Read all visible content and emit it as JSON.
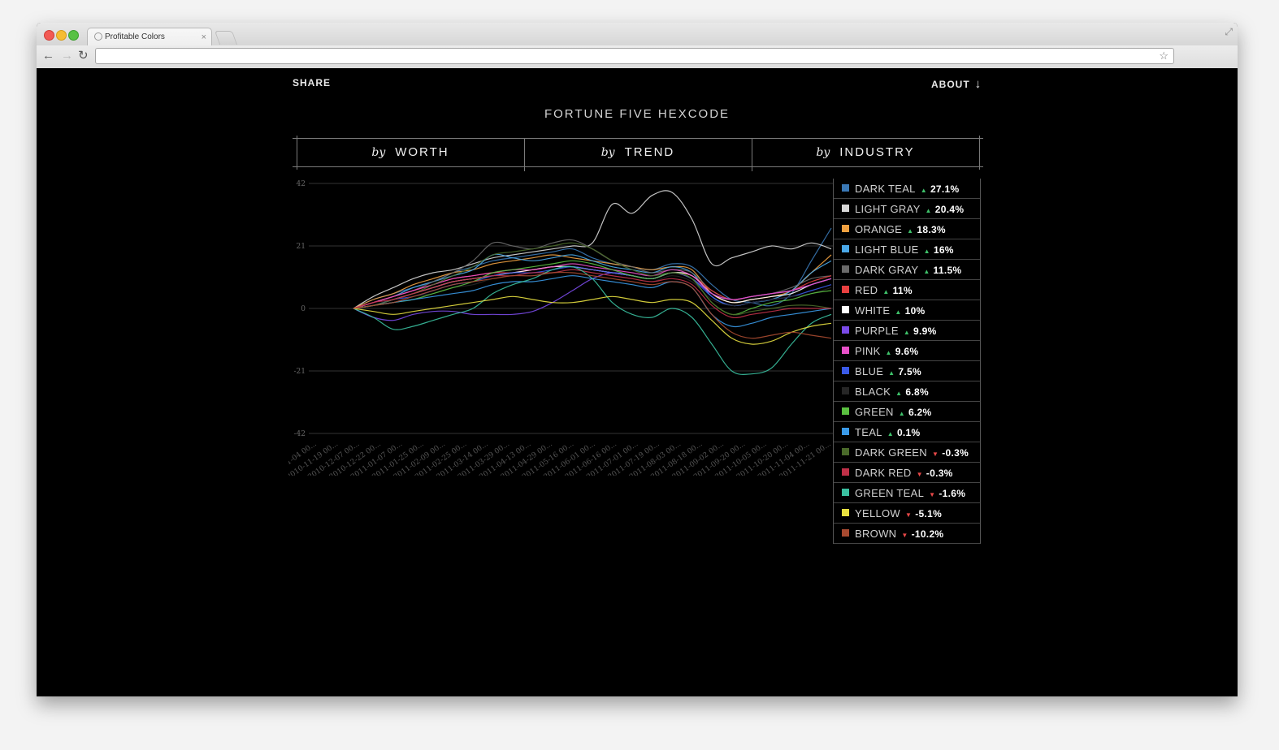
{
  "browser": {
    "tab_title": "Profitable Colors",
    "tab_close": "×",
    "back_glyph": "←",
    "forward_glyph": "→",
    "reload_glyph": "↻",
    "star_glyph": "☆",
    "fullscreen_glyph": "⤢",
    "url": ""
  },
  "header": {
    "share_label": "SHARE",
    "about_label": "ABOUT",
    "about_arrow": "↓",
    "title": "FORTUNE FIVE HEXCODE"
  },
  "tabs": [
    {
      "by": "by",
      "label": "WORTH"
    },
    {
      "by": "by",
      "label": "TREND"
    },
    {
      "by": "by",
      "label": "INDUSTRY"
    }
  ],
  "legend": [
    {
      "name": "DARK TEAL",
      "dir": "up",
      "pct": "27.1%",
      "color": "#3a78b5"
    },
    {
      "name": "LIGHT GRAY",
      "dir": "up",
      "pct": "20.4%",
      "color": "#d8d8d8"
    },
    {
      "name": "ORANGE",
      "dir": "up",
      "pct": "18.3%",
      "color": "#f0a040"
    },
    {
      "name": "LIGHT BLUE",
      "dir": "up",
      "pct": "16%",
      "color": "#4aa8e8"
    },
    {
      "name": "DARK GRAY",
      "dir": "up",
      "pct": "11.5%",
      "color": "#6a6a6a"
    },
    {
      "name": "RED",
      "dir": "up",
      "pct": "11%",
      "color": "#e84040"
    },
    {
      "name": "WHITE",
      "dir": "up",
      "pct": "10%",
      "color": "#ffffff"
    },
    {
      "name": "PURPLE",
      "dir": "up",
      "pct": "9.9%",
      "color": "#7a4ae8"
    },
    {
      "name": "PINK",
      "dir": "up",
      "pct": "9.6%",
      "color": "#e850c8"
    },
    {
      "name": "BLUE",
      "dir": "up",
      "pct": "7.5%",
      "color": "#3a5ae8"
    },
    {
      "name": "BLACK",
      "dir": "up",
      "pct": "6.8%",
      "color": "#262626"
    },
    {
      "name": "GREEN",
      "dir": "up",
      "pct": "6.2%",
      "color": "#5ac040"
    },
    {
      "name": "TEAL",
      "dir": "up",
      "pct": "0.1%",
      "color": "#3a9ae8"
    },
    {
      "name": "DARK GREEN",
      "dir": "down",
      "pct": "-0.3%",
      "color": "#4a6a2a"
    },
    {
      "name": "DARK RED",
      "dir": "down",
      "pct": "-0.3%",
      "color": "#c03048"
    },
    {
      "name": "GREEN TEAL",
      "dir": "down",
      "pct": "-1.6%",
      "color": "#3ac0a0"
    },
    {
      "name": "YELLOW",
      "dir": "down",
      "pct": "-5.1%",
      "color": "#e8e040"
    },
    {
      "name": "BROWN",
      "dir": "down",
      "pct": "-10.2%",
      "color": "#a84a30"
    }
  ],
  "colors": {
    "up": "#3ec26a",
    "down": "#e84848",
    "grid": "#333333",
    "axis_text": "#666666"
  },
  "chart_data": {
    "type": "line",
    "ylim": [
      -42,
      42
    ],
    "yticks": [
      "42",
      "21",
      "0",
      "-21",
      "-42"
    ],
    "xticks": [
      "2010-11-04 00...",
      "2010-11-19 00...",
      "2010-12-07 00...",
      "2010-12-22 00...",
      "2011-01-07 00...",
      "2011-01-25 00...",
      "2011-02-09 00...",
      "2011-02-25 00...",
      "2011-03-14 00...",
      "2011-03-29 00...",
      "2011-04-13 00...",
      "2011-04-29 00...",
      "2011-05-16 00...",
      "2011-06-01 00...",
      "2011-06-16 00...",
      "2011-07-01 00...",
      "2011-07-19 00...",
      "2011-08-03 00...",
      "2011-08-18 00...",
      "2011-09-02 00...",
      "2011-09-20 00...",
      "2011-10-05 00...",
      "2011-10-20 00...",
      "2011-11-04 00...",
      "2011-11-21 00..."
    ],
    "series": [
      {
        "name": "DARK TEAL",
        "color": "#3a78b5",
        "values": [
          0,
          3,
          5,
          7,
          9,
          12,
          14,
          16,
          17,
          18,
          19,
          20,
          17,
          15,
          14,
          13,
          15,
          14,
          8,
          3,
          2,
          1,
          5,
          16,
          27
        ]
      },
      {
        "name": "LIGHT GRAY",
        "color": "#d8d8d8",
        "values": [
          0,
          4,
          7,
          10,
          12,
          13,
          15,
          17,
          18,
          19,
          20,
          21,
          22,
          35,
          32,
          38,
          39,
          30,
          15,
          17,
          19,
          21,
          20,
          22,
          20
        ]
      },
      {
        "name": "ORANGE",
        "color": "#f0a040",
        "values": [
          0,
          3,
          5,
          8,
          10,
          12,
          13,
          15,
          16,
          17,
          18,
          17,
          16,
          15,
          14,
          13,
          14,
          13,
          5,
          2,
          3,
          4,
          6,
          12,
          18
        ]
      },
      {
        "name": "LIGHT BLUE",
        "color": "#4aa8e8",
        "values": [
          0,
          2,
          4,
          7,
          9,
          11,
          13,
          18,
          17,
          16,
          17,
          18,
          16,
          14,
          13,
          12,
          14,
          12,
          4,
          1,
          2,
          3,
          6,
          12,
          16
        ]
      },
      {
        "name": "DARK GRAY",
        "color": "#6a6a6a",
        "values": [
          0,
          2,
          4,
          6,
          9,
          12,
          16,
          22,
          21,
          20,
          22,
          23,
          20,
          16,
          14,
          12,
          13,
          12,
          6,
          3,
          4,
          5,
          7,
          10,
          11
        ]
      },
      {
        "name": "RED",
        "color": "#e84040",
        "values": [
          0,
          2,
          4,
          6,
          8,
          10,
          11,
          12,
          12,
          13,
          14,
          14,
          13,
          12,
          11,
          10,
          12,
          11,
          6,
          3,
          4,
          5,
          6,
          9,
          11
        ]
      },
      {
        "name": "WHITE",
        "color": "#ffffff",
        "values": [
          0,
          1,
          3,
          5,
          7,
          9,
          10,
          11,
          12,
          13,
          14,
          14,
          13,
          12,
          11,
          10,
          12,
          11,
          5,
          2,
          3,
          4,
          5,
          8,
          10
        ]
      },
      {
        "name": "PURPLE",
        "color": "#7a4ae8",
        "values": [
          0,
          -3,
          -4,
          -2,
          -1,
          -1,
          -2,
          -2,
          -2,
          -1,
          2,
          6,
          10,
          12,
          11,
          10,
          12,
          10,
          5,
          3,
          4,
          5,
          6,
          8,
          10
        ]
      },
      {
        "name": "PINK",
        "color": "#e850c8",
        "values": [
          0,
          2,
          4,
          6,
          8,
          10,
          11,
          12,
          13,
          13,
          14,
          15,
          14,
          13,
          12,
          11,
          13,
          11,
          5,
          3,
          4,
          5,
          6,
          8,
          10
        ]
      },
      {
        "name": "BLUE",
        "color": "#3a5ae8",
        "values": [
          0,
          1,
          3,
          4,
          6,
          8,
          9,
          11,
          12,
          12,
          13,
          14,
          13,
          12,
          11,
          10,
          12,
          10,
          4,
          1,
          2,
          3,
          4,
          6,
          8
        ]
      },
      {
        "name": "BLACK",
        "color": "#262626",
        "values": [
          0,
          1,
          2,
          4,
          5,
          7,
          8,
          10,
          11,
          11,
          12,
          13,
          12,
          11,
          10,
          9,
          11,
          9,
          3,
          1,
          2,
          3,
          4,
          5,
          7
        ]
      },
      {
        "name": "GREEN",
        "color": "#5ac040",
        "values": [
          0,
          1,
          2,
          3,
          5,
          7,
          9,
          12,
          13,
          14,
          15,
          16,
          15,
          13,
          11,
          10,
          12,
          10,
          2,
          -2,
          0,
          2,
          3,
          5,
          6
        ]
      },
      {
        "name": "TEAL",
        "color": "#3a9ae8",
        "values": [
          0,
          1,
          2,
          3,
          4,
          5,
          6,
          8,
          9,
          9,
          10,
          11,
          10,
          9,
          8,
          7,
          9,
          7,
          -2,
          -6,
          -5,
          -3,
          -2,
          -1,
          0
        ]
      },
      {
        "name": "DARK GREEN",
        "color": "#4a6a2a",
        "values": [
          0,
          1,
          3,
          5,
          8,
          11,
          14,
          18,
          19,
          20,
          21,
          22,
          20,
          16,
          13,
          11,
          12,
          10,
          2,
          -2,
          -1,
          0,
          1,
          1,
          0
        ]
      },
      {
        "name": "DARK RED",
        "color": "#c03048",
        "values": [
          0,
          2,
          3,
          5,
          7,
          9,
          10,
          11,
          11,
          12,
          12,
          13,
          12,
          11,
          10,
          9,
          10,
          8,
          1,
          -3,
          -2,
          -1,
          0,
          0,
          0
        ]
      },
      {
        "name": "GREEN TEAL",
        "color": "#3ac0a0",
        "values": [
          0,
          -3,
          -7,
          -6,
          -4,
          -2,
          0,
          5,
          8,
          10,
          13,
          14,
          10,
          2,
          -2,
          -3,
          0,
          -3,
          -12,
          -21,
          -22,
          -20,
          -12,
          -5,
          -2
        ]
      },
      {
        "name": "YELLOW",
        "color": "#e8e040",
        "values": [
          0,
          -1,
          -2,
          -1,
          0,
          1,
          2,
          3,
          4,
          3,
          2,
          2,
          3,
          4,
          3,
          2,
          3,
          2,
          -4,
          -10,
          -12,
          -11,
          -8,
          -6,
          -5
        ]
      },
      {
        "name": "BROWN",
        "color": "#a84a30",
        "values": [
          0,
          1,
          2,
          4,
          6,
          8,
          9,
          10,
          11,
          11,
          12,
          12,
          11,
          10,
          9,
          8,
          9,
          7,
          -2,
          -8,
          -10,
          -9,
          -8,
          -9,
          -10
        ]
      }
    ]
  }
}
